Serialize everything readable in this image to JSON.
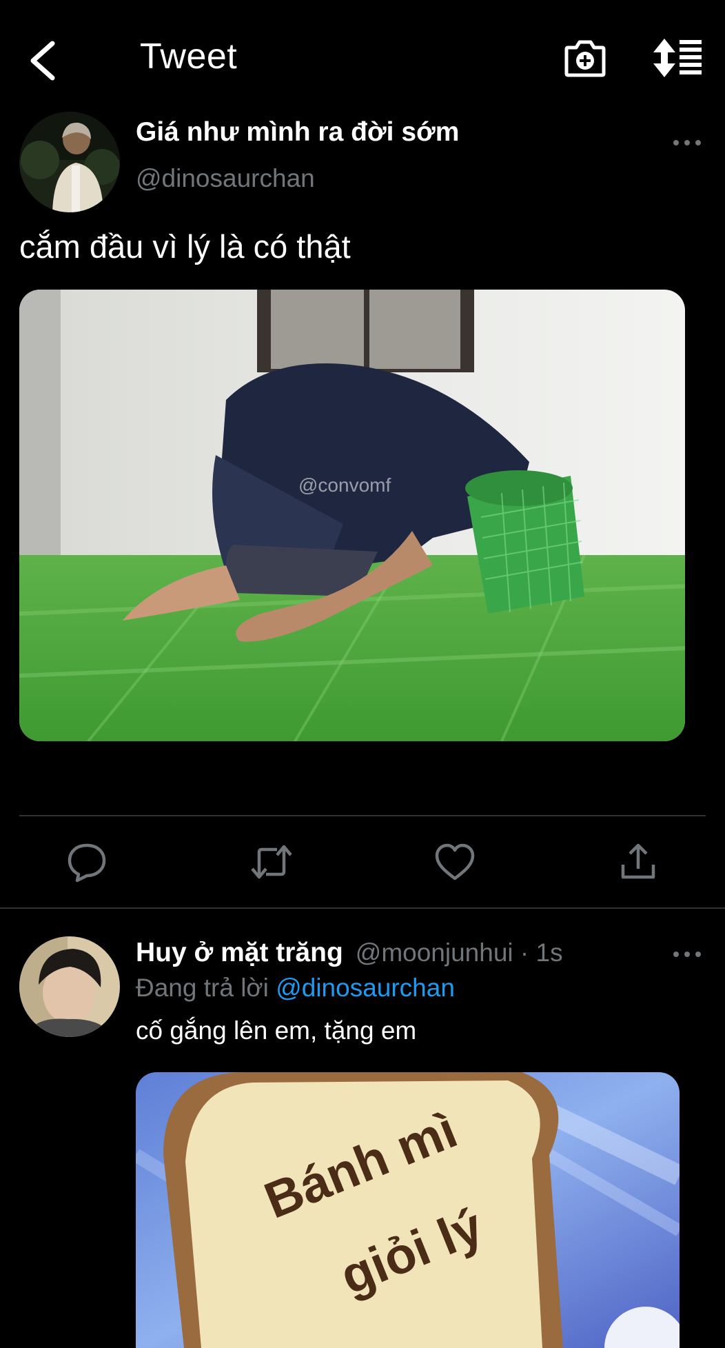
{
  "header": {
    "back_icon": "chevron-left-icon",
    "title": "Tweet",
    "camera_icon": "camera-plus-icon",
    "sort_icon": "sort-list-icon"
  },
  "tweet": {
    "display_name": "Giá như mình ra đời sớm",
    "handle": "@dinosaurchan",
    "text": "cắm đầu vì lý là có thật",
    "media_watermark": "@convomf",
    "actions": [
      "reply-icon",
      "retweet-icon",
      "like-icon",
      "share-icon"
    ]
  },
  "reply": {
    "display_name": "Huy ở mặt trăng",
    "handle_time": "@moonjunhui · 1s",
    "replying_prefix": "Đang trả lời",
    "replying_to": "@dinosaurchan",
    "text": "cố gắng lên em, tặng em",
    "media_text_line1": "Bánh mì",
    "media_text_line2": "giỏi lý"
  },
  "colors": {
    "background": "#000000",
    "text": "#ffffff",
    "secondary": "#71767b",
    "accent": "#1d9bf0",
    "divider": "#2f3336"
  }
}
